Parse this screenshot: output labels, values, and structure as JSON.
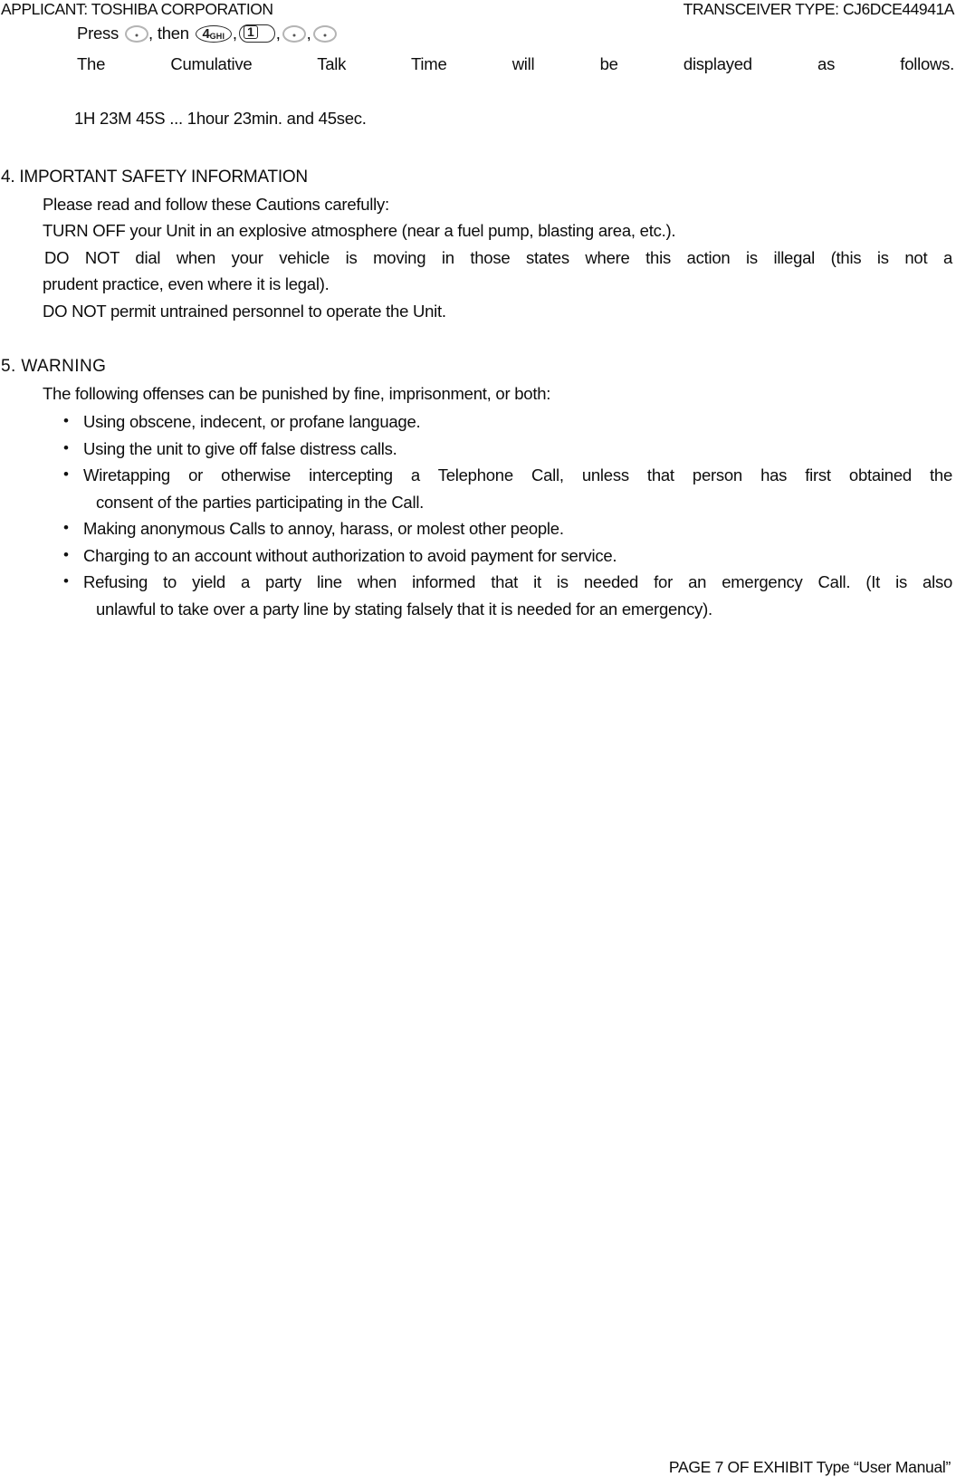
{
  "header": {
    "applicant": "APPLICANT: TOSHIBA CORPORATION",
    "transceiver": "TRANSCEIVER TYPE: CJ6DCE44941A"
  },
  "press_instruction": {
    "press_label": "Press",
    "then_label": ", then",
    "separator": ",",
    "keys": [
      {
        "name": "blank-key-1",
        "label": "",
        "type": "blank"
      },
      {
        "name": "key-4-ghi",
        "label": "4",
        "sublabel": "GHI",
        "type": "digit"
      },
      {
        "name": "key-1",
        "label": "1",
        "type": "digit"
      },
      {
        "name": "blank-key-2",
        "label": "",
        "type": "blank"
      },
      {
        "name": "blank-key-3",
        "label": "",
        "type": "blank"
      }
    ]
  },
  "cumulative_line": "The Cumulative Talk Time will be displayed as follows.",
  "example_line": "1H 23M 45S ... 1hour 23min. and 45sec.",
  "section_4": {
    "heading": "4. IMPORTANT SAFETY INFORMATION",
    "lines": [
      "Please read and follow these Cautions carefully:",
      "TURN OFF your Unit in an explosive atmosphere (near a fuel pump, blasting area, etc.)."
    ],
    "justified_paragraph": "DO NOT dial when your vehicle is moving in those states where this action is illegal (this is not a",
    "justified_paragraph_cont": "prudent practice, even where it is legal).",
    "closing_line": "DO NOT permit untrained personnel to operate the Unit."
  },
  "section_5": {
    "heading": "5. WARNING",
    "intro": "The following offenses can be punished by fine, imprisonment, or both:",
    "bullets": [
      {
        "text": "Using obscene, indecent, or profane language.",
        "cont": ""
      },
      {
        "text": "Using the unit to give off false distress calls.",
        "cont": ""
      },
      {
        "text": "Wiretapping or otherwise intercepting a Telephone Call, unless that person has first obtained the",
        "cont": "consent of the parties participating in the Call."
      },
      {
        "text": "Making anonymous Calls to annoy, harass, or molest other people.",
        "cont": ""
      },
      {
        "text": "Charging to an account without authorization to avoid payment for service.",
        "cont": ""
      },
      {
        "text": "Refusing to yield a party line when informed that it is needed for an emergency Call. (It is also",
        "cont": "unlawful to take over a party line by stating falsely that it is needed for an emergency)."
      }
    ]
  },
  "footer": {
    "text": "PAGE 7 OF EXHIBIT Type “User Manual”"
  }
}
